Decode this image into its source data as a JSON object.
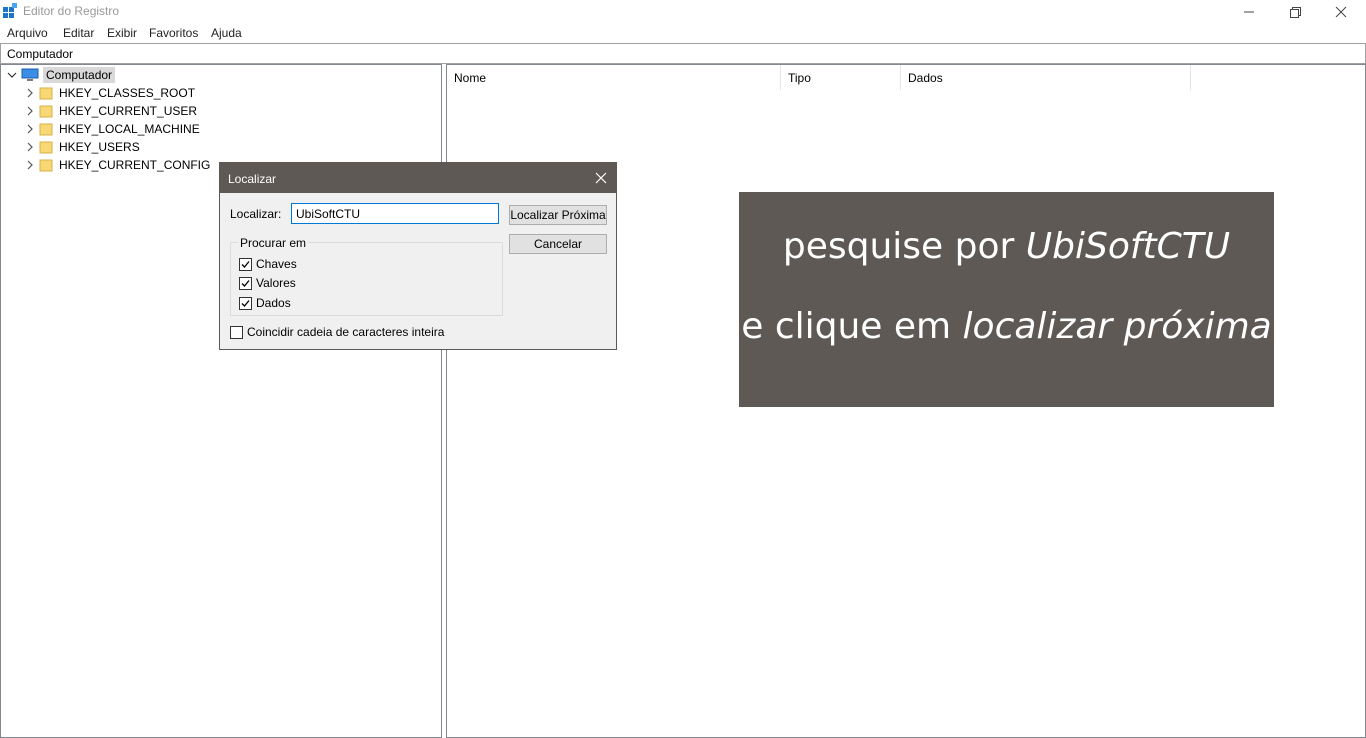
{
  "window": {
    "title": "Editor do Registro"
  },
  "menu": [
    "Arquivo",
    "Editar",
    "Exibir",
    "Favoritos",
    "Ajuda"
  ],
  "address": "Computador",
  "tree": {
    "root": "Computador",
    "items": [
      "HKEY_CLASSES_ROOT",
      "HKEY_CURRENT_USER",
      "HKEY_LOCAL_MACHINE",
      "HKEY_USERS",
      "HKEY_CURRENT_CONFIG"
    ]
  },
  "list": {
    "columns": [
      "Nome",
      "Tipo",
      "Dados"
    ]
  },
  "dialog": {
    "title": "Localizar",
    "find_label": "Localizar:",
    "find_value": "UbiSoftCTU",
    "find_next": "Localizar Próxima",
    "cancel": "Cancelar",
    "search_in": "Procurar em",
    "options": [
      {
        "label": "Chaves",
        "checked": true
      },
      {
        "label": "Valores",
        "checked": true
      },
      {
        "label": "Dados",
        "checked": true
      }
    ],
    "match_whole": {
      "label": "Coincidir cadeia de caracteres inteira",
      "checked": false
    }
  },
  "overlay": {
    "line1_plain": "pesquise por ",
    "line1_italic": "UbiSoftCTU",
    "line2_plain": "e clique em ",
    "line2_italic": "localizar próxima"
  },
  "colors": {
    "dialog_header": "#5e5955",
    "overlay_bg": "#5e5955",
    "field_border": "#0078d7",
    "folder": "#f8d775"
  }
}
